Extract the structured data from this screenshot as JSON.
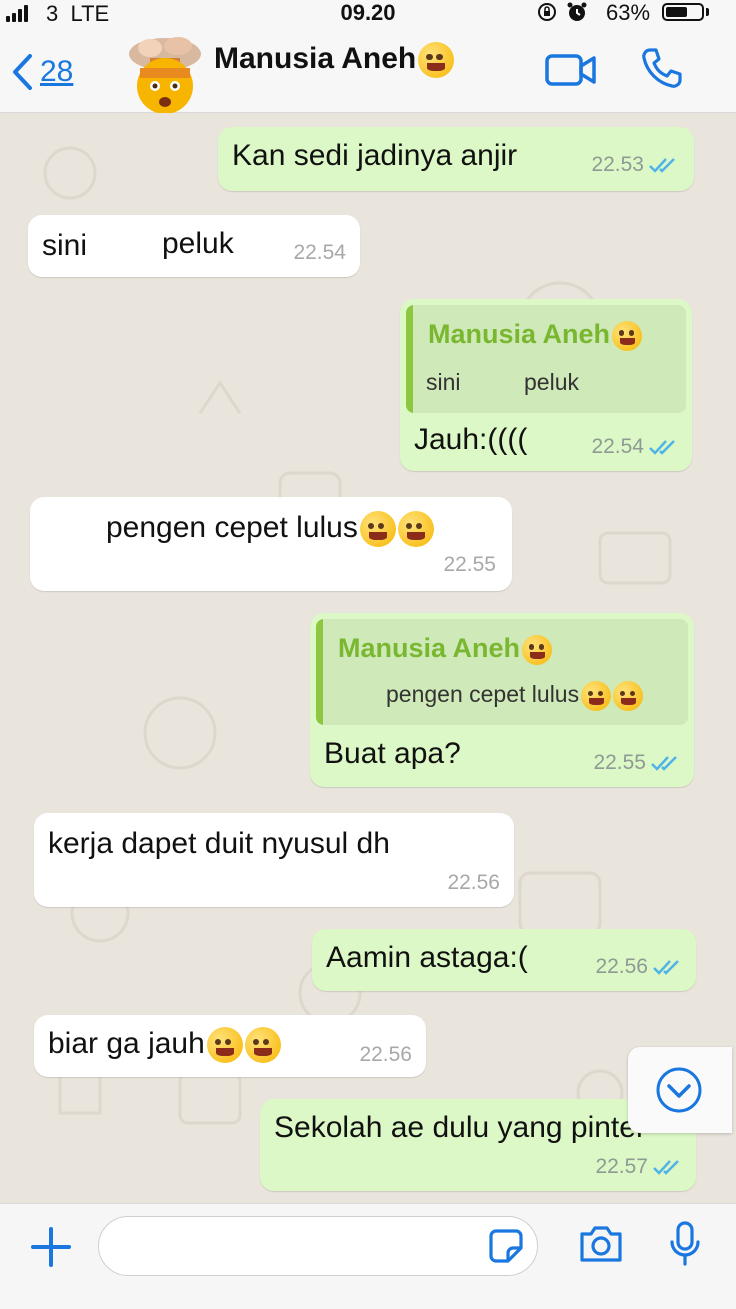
{
  "status_bar": {
    "carrier": "3",
    "network": "LTE",
    "time": "09.20",
    "battery": "63%",
    "battery_level": 0.63
  },
  "header": {
    "back_count": "28",
    "contact_name": "Manusia Aneh"
  },
  "messages": [
    {
      "type": "out",
      "text": "Kan sedi jadinya anjir",
      "time": "22.53"
    },
    {
      "type": "in",
      "text_a": "sini",
      "text_b": "peluk",
      "time": "22.54"
    },
    {
      "type": "out",
      "quote_name": "Manusia Aneh",
      "quote_a": "sini",
      "quote_b": "peluk",
      "text": "Jauh:((((",
      "time": "22.54"
    },
    {
      "type": "in",
      "text": "pengen cepet lulus",
      "time": "22.55"
    },
    {
      "type": "out",
      "quote_name": "Manusia Aneh",
      "quote_text": "pengen cepet lulus",
      "text": "Buat apa?",
      "time": "22.55"
    },
    {
      "type": "in",
      "text": "kerja dapet duit nyusul dh",
      "time": "22.56"
    },
    {
      "type": "out",
      "text": "Aamin astaga:(",
      "time": "22.56"
    },
    {
      "type": "in",
      "text": "biar ga jauh",
      "time": "22.56"
    },
    {
      "type": "out",
      "text": "Sekolah ae dulu yang pinter",
      "time": "22.57"
    }
  ],
  "input": {
    "placeholder": ""
  },
  "colors": {
    "accent": "#1a77e0",
    "outgoing_bubble": "#dcf8c6",
    "incoming_bubble": "#ffffff",
    "read_ticks": "#4fb3e8",
    "quote_name": "#7ab730",
    "chat_background": "#e9e4dc"
  },
  "icons": [
    "signal-icon",
    "alarm-icon",
    "lock-rotation-icon",
    "battery-icon",
    "back-chevron-icon",
    "avatar-exploding-head",
    "video-call-icon",
    "phone-icon",
    "scroll-down-icon",
    "plus-icon",
    "sticker-icon",
    "camera-icon",
    "microphone-icon",
    "double-check-icon"
  ]
}
